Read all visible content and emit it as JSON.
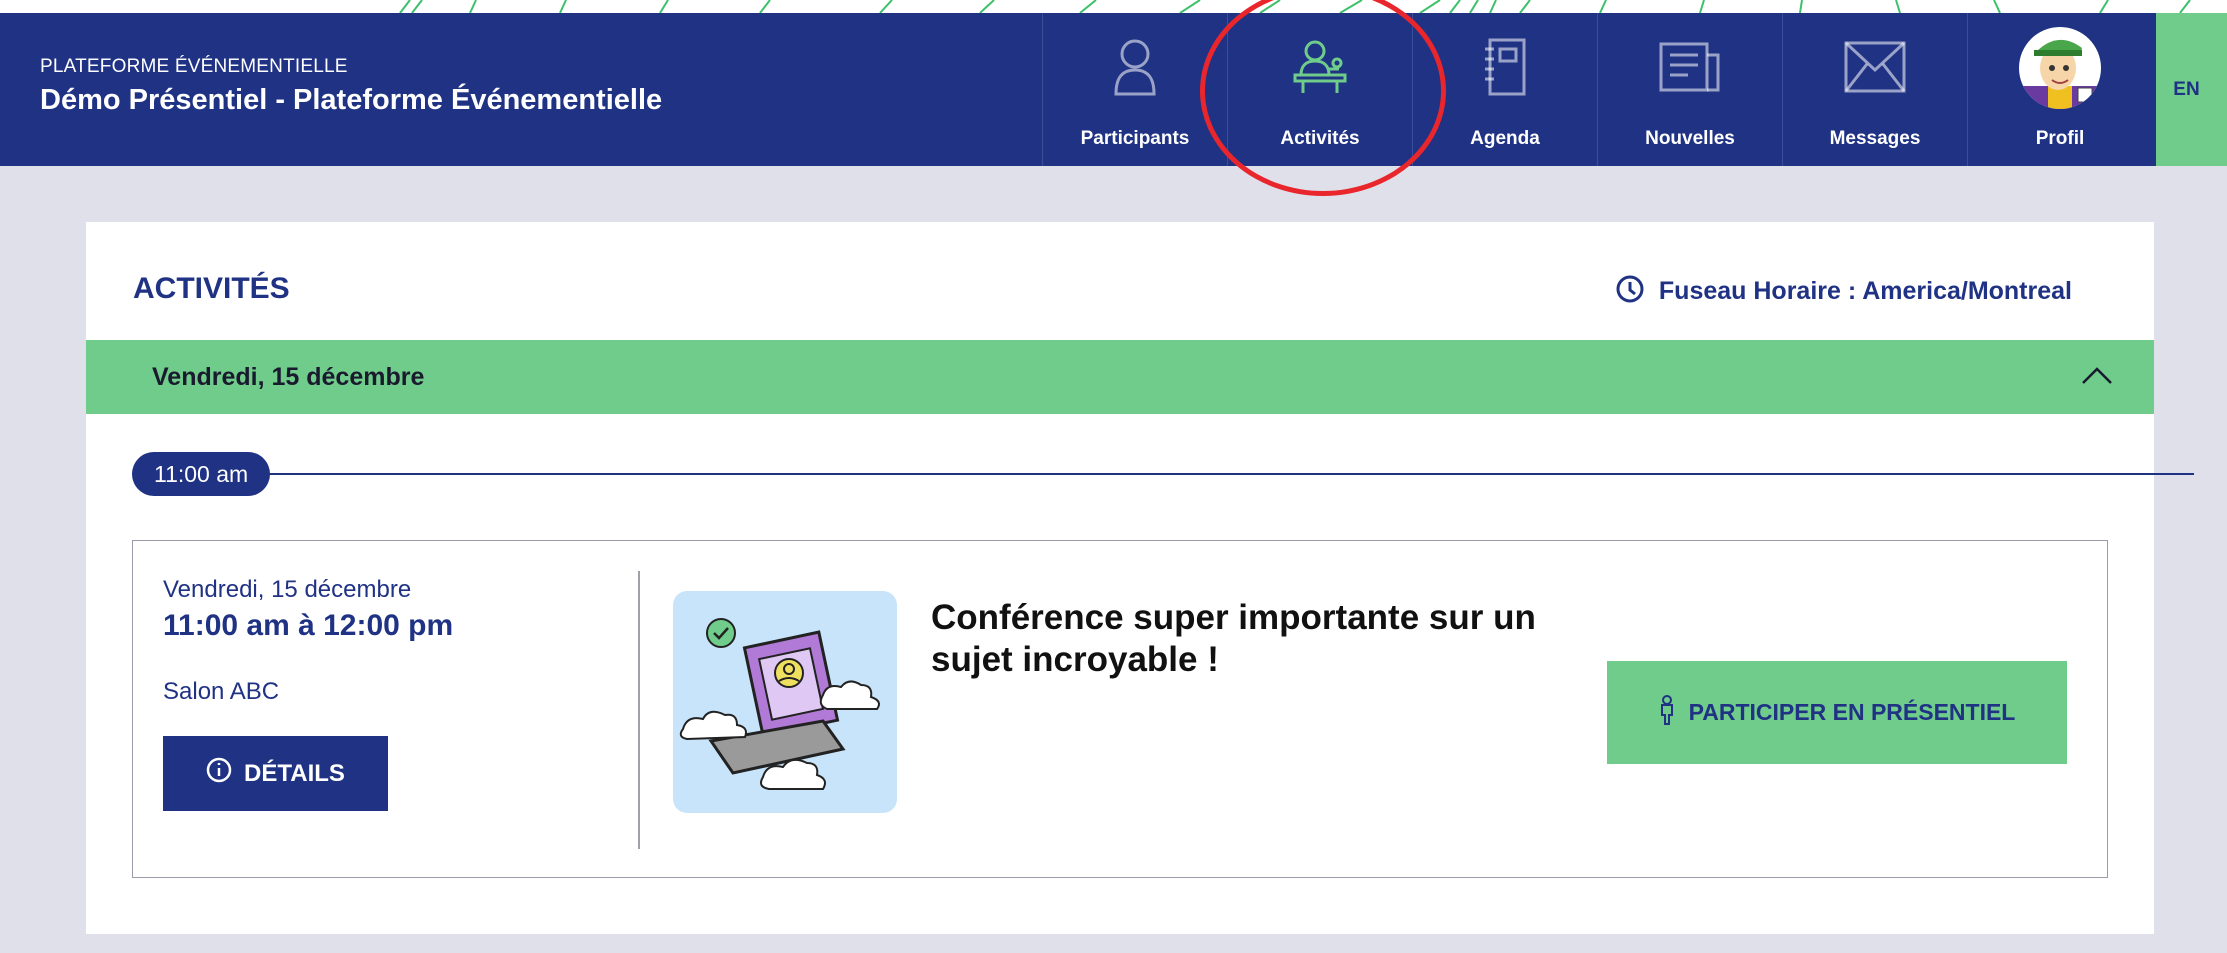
{
  "header": {
    "subtitle": "PLATEFORME ÉVÉNEMENTIELLE",
    "title": "Démo Présentiel - Plateforme Événementielle",
    "nav": [
      {
        "label": "Participants",
        "icon": "person-icon",
        "active": false
      },
      {
        "label": "Activités",
        "icon": "presenter-icon",
        "active": true
      },
      {
        "label": "Agenda",
        "icon": "notebook-icon",
        "active": false
      },
      {
        "label": "Nouvelles",
        "icon": "newspaper-icon",
        "active": false
      },
      {
        "label": "Messages",
        "icon": "envelope-icon",
        "active": false
      },
      {
        "label": "Profil",
        "icon": "avatar",
        "active": false
      }
    ],
    "lang": "EN"
  },
  "colors": {
    "primary": "#1f3284",
    "accent": "#6fcc8a",
    "highlight": "#e8262b",
    "background": "#e0e0ea"
  },
  "main": {
    "title": "ACTIVITÉS",
    "timezone_label": "Fuseau Horaire : America/Montreal",
    "day": "Vendredi, 15 décembre",
    "time_slot": "11:00 am",
    "activity": {
      "date": "Vendredi, 15 décembre",
      "time": "11:00 am à 12:00 pm",
      "room": "Salon ABC",
      "details_label": "DÉTAILS",
      "title": "Conférence super importante sur un sujet incroyable !",
      "participate_label": "PARTICIPER EN PRÉSENTIEL"
    }
  }
}
